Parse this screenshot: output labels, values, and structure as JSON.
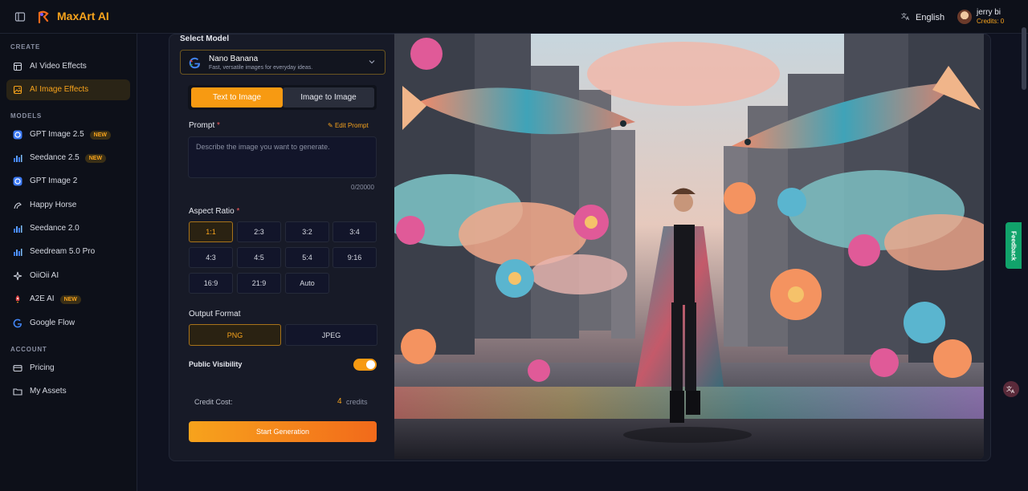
{
  "app": {
    "brand": "MaxArt AI"
  },
  "header": {
    "language": "English",
    "user_name": "jerry bi",
    "credits": "Credits: 0"
  },
  "sidebar": {
    "sections": {
      "create": "CREATE",
      "models": "MODELS",
      "account": "ACCOUNT"
    },
    "create_items": [
      {
        "label": "AI Video Effects",
        "icon": "video-icon"
      },
      {
        "label": "AI Image Effects",
        "icon": "image-icon",
        "active": true
      }
    ],
    "model_items": [
      {
        "label": "GPT Image 2.5",
        "badge": "NEW"
      },
      {
        "label": "Seedance 2.5",
        "badge": "NEW"
      },
      {
        "label": "GPT Image 2"
      },
      {
        "label": "Happy Horse"
      },
      {
        "label": "Seedance 2.0"
      },
      {
        "label": "Seedream 5.0 Pro"
      },
      {
        "label": "OiiOii AI"
      },
      {
        "label": "A2E AI",
        "badge": "NEW"
      },
      {
        "label": "Google Flow"
      }
    ],
    "account_items": [
      {
        "label": "Pricing"
      },
      {
        "label": "My Assets"
      }
    ]
  },
  "form": {
    "select_model_label": "Select Model",
    "model": {
      "name": "Nano Banana",
      "description": "Fast, versatile images for everyday ideas."
    },
    "tabs": {
      "text_to_image": "Text to Image",
      "image_to_image": "Image to Image"
    },
    "prompt_label": "Prompt",
    "required_mark": "*",
    "edit_prompt": "Edit Prompt",
    "prompt_placeholder": "Describe the image you want to generate.",
    "counter": "0/20000",
    "aspect_ratio_label": "Aspect Ratio",
    "aspect_ratios": [
      "1:1",
      "2:3",
      "3:2",
      "3:4",
      "4:3",
      "4:5",
      "5:4",
      "9:16",
      "16:9",
      "21:9",
      "Auto"
    ],
    "selected_ratio": "1:1",
    "output_format_label": "Output Format",
    "formats": [
      "PNG",
      "JPEG"
    ],
    "selected_format": "PNG",
    "public_visibility_label": "Public Visibility",
    "public_visibility_on": true,
    "credit_cost_label": "Credit Cost:",
    "credit_cost_value": "4",
    "credit_cost_unit": "credits",
    "generate_button": "Start Generation"
  },
  "widgets": {
    "feedback": "Feedback"
  },
  "colors": {
    "accent": "#f7a31c",
    "feedback": "#11a36b",
    "background": "#0f1220"
  }
}
